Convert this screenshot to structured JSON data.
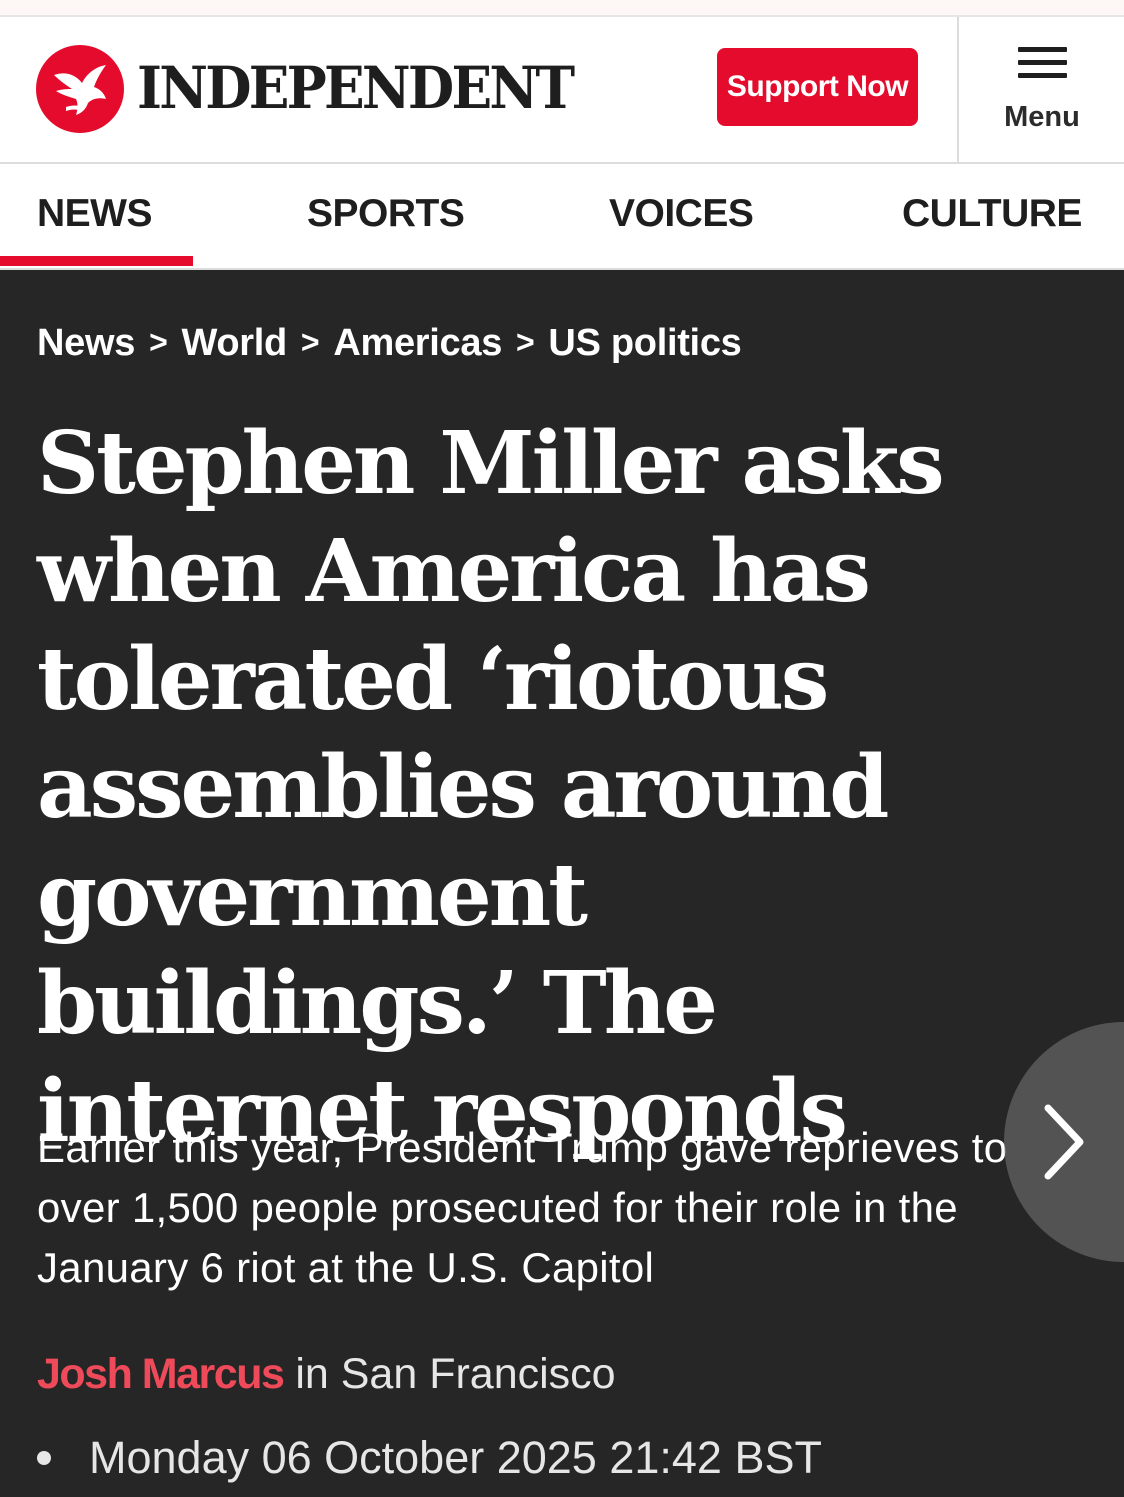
{
  "header": {
    "brand_name": "INDEPENDENT",
    "support_label": "Support Now",
    "menu_label": "Menu",
    "logo_icon": "eagle-logo-icon",
    "menu_icon": "hamburger-menu-icon"
  },
  "nav": {
    "items": [
      {
        "label": "NEWS",
        "active": true
      },
      {
        "label": "SPORTS",
        "active": false
      },
      {
        "label": "VOICES",
        "active": false
      },
      {
        "label": "CULTURE",
        "active": false
      }
    ]
  },
  "breadcrumb": {
    "items": [
      "News",
      "World",
      "Americas",
      "US politics"
    ],
    "separator": ">"
  },
  "article": {
    "headline": "Stephen Miller asks when America has tolerated ‘riotous assemblies around government buildings.’ The internet responds",
    "standfirst": "Earlier this year, President Trump gave reprieves to over 1,500 people prosecuted for their role in the January 6 riot at the U.S. Capitol",
    "author": "Josh Marcus",
    "location_text": " in San Francisco",
    "date": "Monday 06 October 2025 21:42 BST"
  },
  "colors": {
    "brand_red": "#e40b2c",
    "hero_background": "#262626",
    "author_color": "#ef4a5a"
  },
  "icons": {
    "next": "chevron-right-icon"
  }
}
